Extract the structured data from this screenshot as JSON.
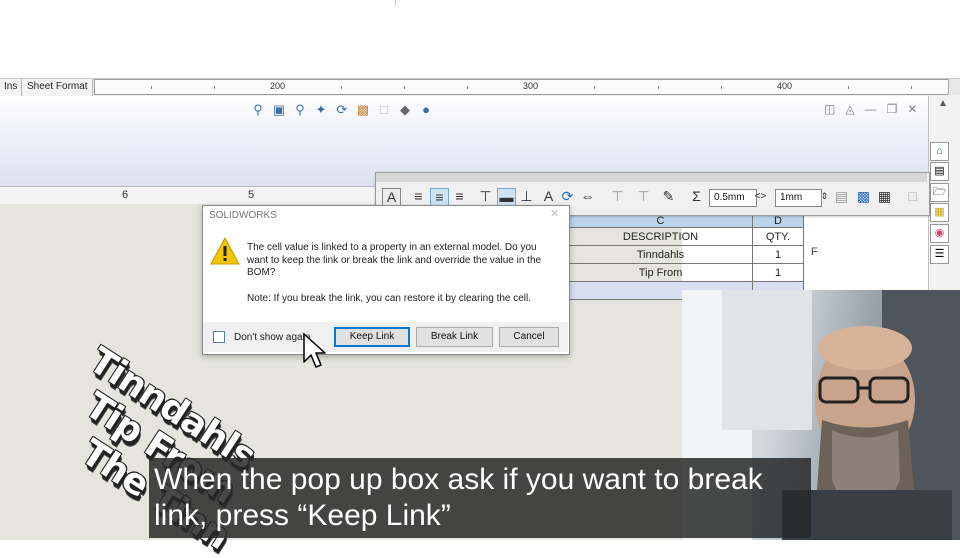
{
  "tabs": [
    {
      "label": "Ins"
    },
    {
      "label": "Sheet Format"
    }
  ],
  "ruler_top": {
    "labels": [
      "200",
      "300",
      "400"
    ]
  },
  "sheet_ruler": {
    "labels": [
      "6",
      "5"
    ]
  },
  "view_toolbar": {
    "icons": [
      "zoom-to-fit-icon",
      "zoom-area-icon",
      "zoom-previous-icon",
      "pan-icon",
      "rotate-icon",
      "display-style-icon",
      "hide-show-icon",
      "view-orientation-icon",
      "scene-icon"
    ]
  },
  "window_controls": [
    "tile-left-icon",
    "tile-right-icon",
    "minimize-icon",
    "restore-icon",
    "close-icon"
  ],
  "format_toolbar": {
    "line_width": "0.5mm",
    "spacing": "1mm",
    "sigma": "Σ"
  },
  "bom": {
    "column_letters": [
      "C",
      "D"
    ],
    "headers": [
      "DESCRIPTION",
      "QTY."
    ],
    "rows": [
      {
        "description": "Tinndahls",
        "qty": "1"
      },
      {
        "description": "Tip From",
        "qty": "1"
      }
    ],
    "row_letter": "F"
  },
  "dialog": {
    "title": "SOLIDWORKS",
    "message": "The cell value is linked to a property in an external model. Do you want to keep the link or break the link and override the value in the BOM?",
    "note": "Note: If you break the link, you can restore it by clearing the cell.",
    "checkbox_label": "Don't show again",
    "checkbox_checked": false,
    "buttons": {
      "keep": "Keep Link",
      "break": "Break Link",
      "cancel": "Cancel"
    }
  },
  "drawing_text": [
    "Tinndahls",
    "Tip From",
    "The Tinn"
  ],
  "caption": "When the pop up box ask if you want to break link, press “Keep Link”",
  "colors": {
    "dialog_default_border": "#0078d7",
    "caption_bg": "#282828",
    "bom_header": "#bcd3ea"
  }
}
